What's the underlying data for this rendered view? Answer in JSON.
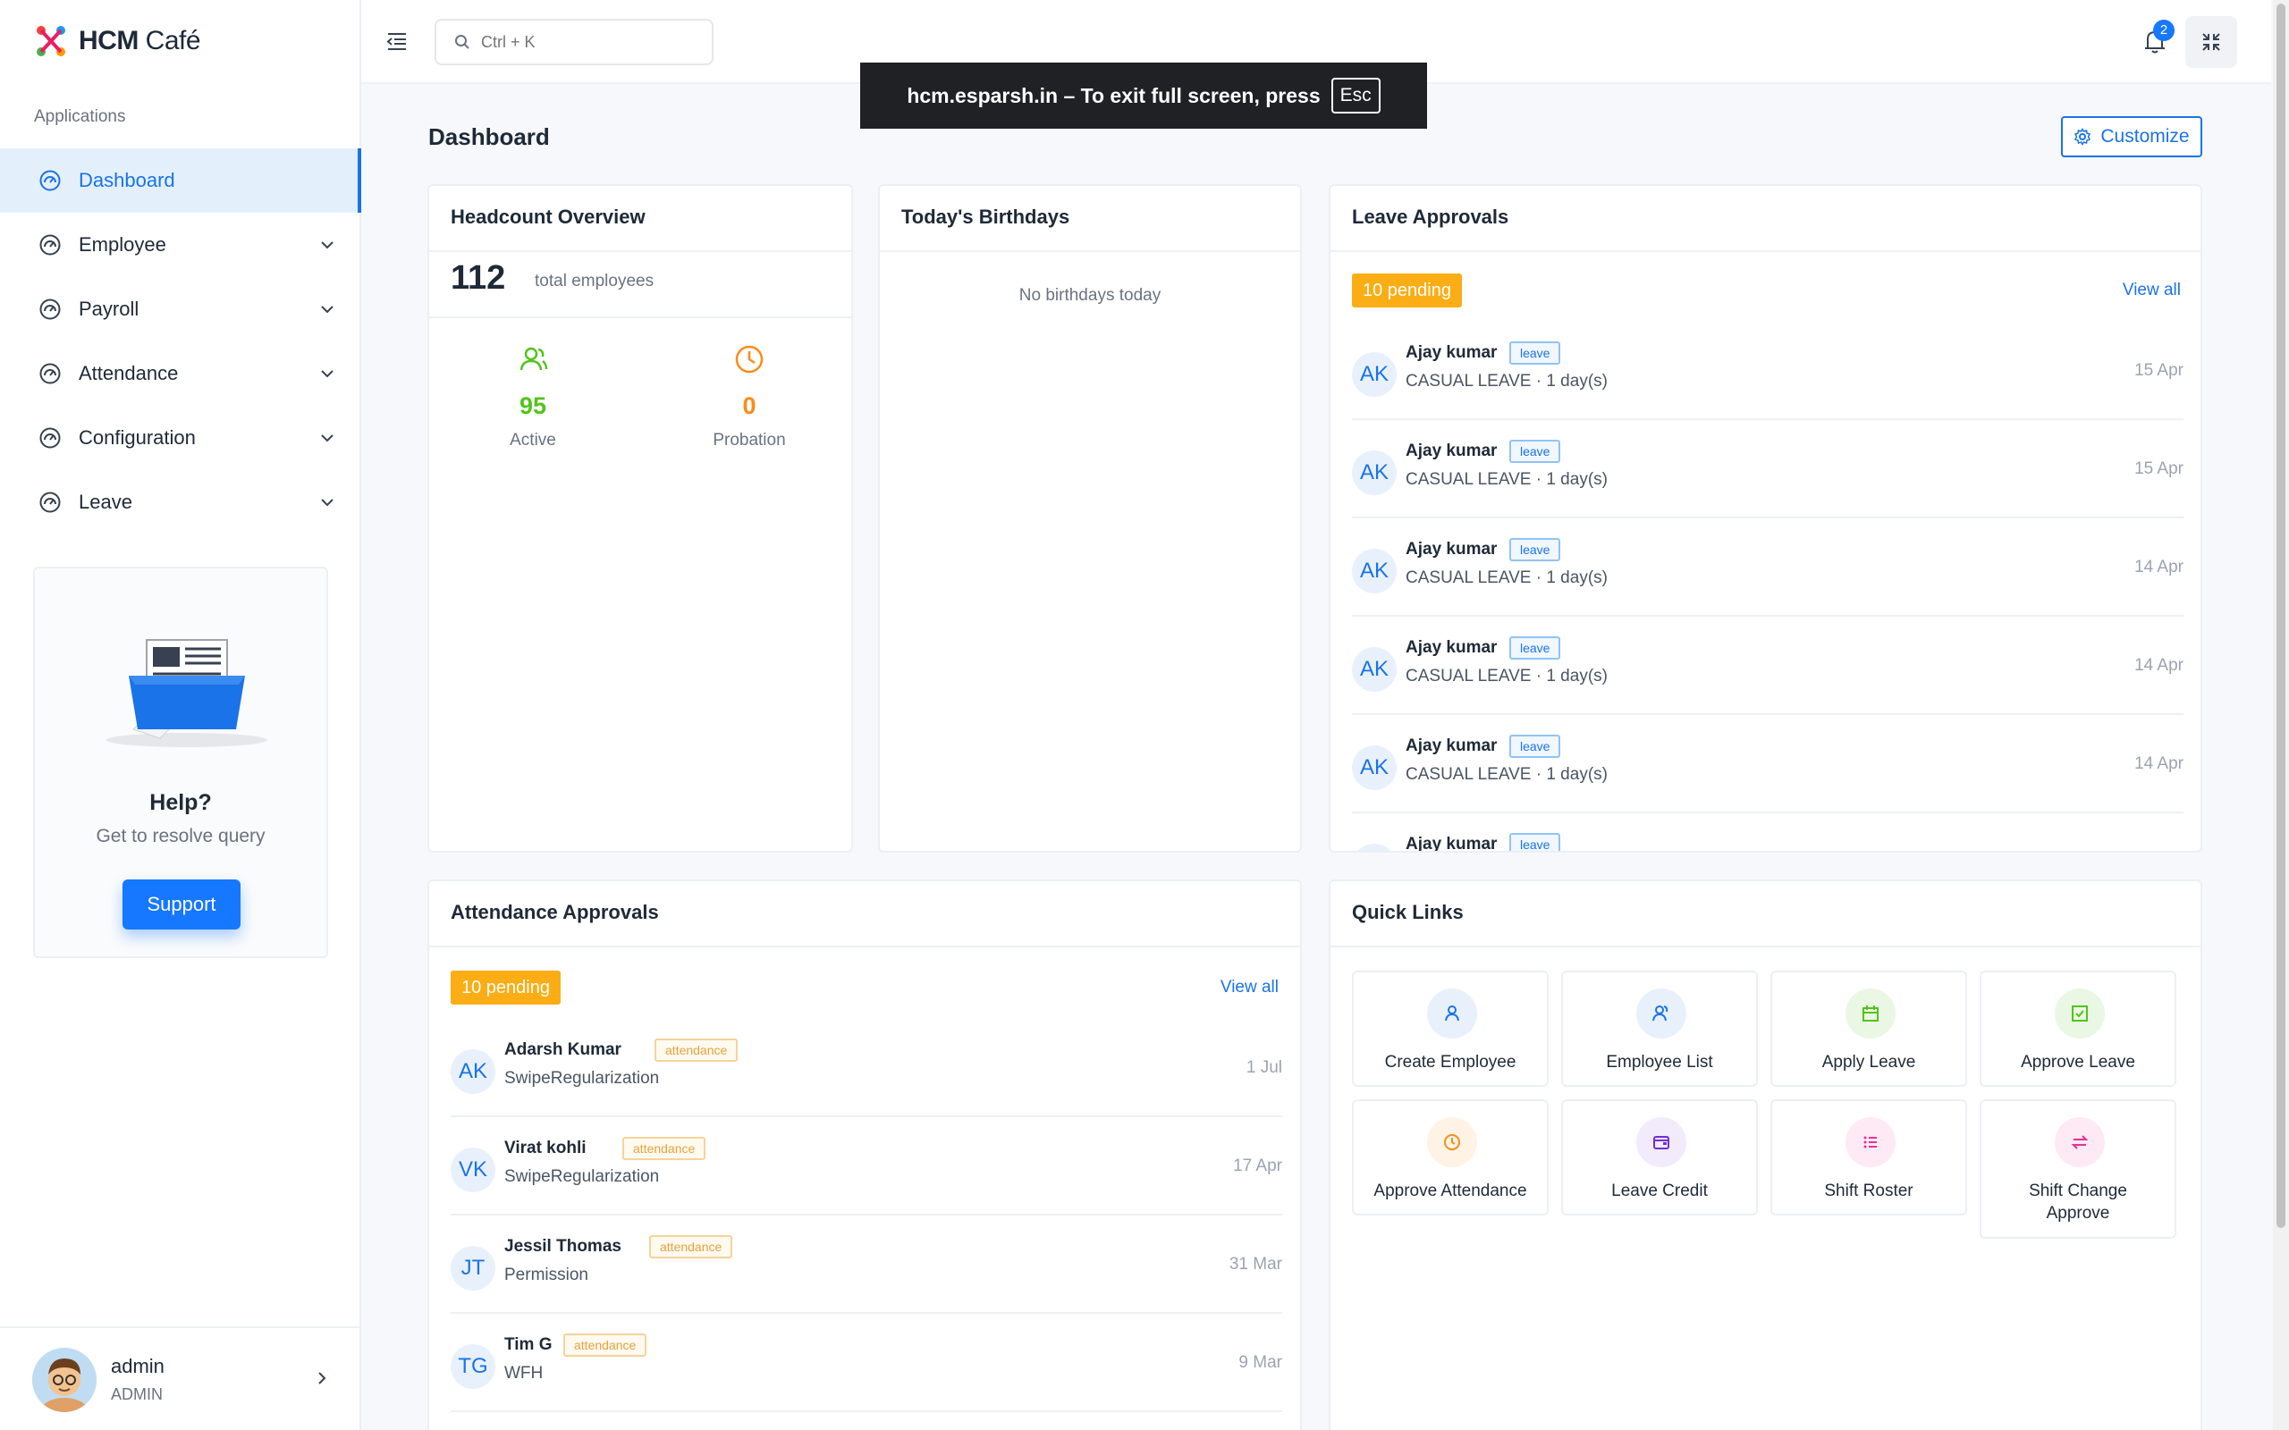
{
  "app": {
    "name_bold": "HCM",
    "name_rest": "Café"
  },
  "sidebar": {
    "section_label": "Applications",
    "items": [
      {
        "label": "Dashboard",
        "icon": "dashboard-icon",
        "active": true
      },
      {
        "label": "Employee",
        "icon": "dashboard-icon"
      },
      {
        "label": "Payroll",
        "icon": "dashboard-icon"
      },
      {
        "label": "Attendance",
        "icon": "dashboard-icon"
      },
      {
        "label": "Configuration",
        "icon": "dashboard-icon"
      },
      {
        "label": "Leave",
        "icon": "dashboard-icon"
      }
    ],
    "help": {
      "title": "Help?",
      "subtitle": "Get to resolve query",
      "button": "Support"
    },
    "user": {
      "name": "admin",
      "role": "ADMIN"
    }
  },
  "topbar": {
    "search_placeholder": "Ctrl + K",
    "notification_count": "2",
    "fullscreen_toast": {
      "text": "hcm.esparsh.in – To exit full screen, press",
      "key": "Esc"
    }
  },
  "page": {
    "title": "Dashboard",
    "customize_label": "Customize"
  },
  "headcount": {
    "title": "Headcount Overview",
    "total": "112",
    "total_label": "total employees",
    "active_value": "95",
    "active_label": "Active",
    "probation_value": "0",
    "probation_label": "Probation"
  },
  "birthdays": {
    "title": "Today's Birthdays",
    "empty": "No birthdays today"
  },
  "leave_approvals": {
    "title": "Leave Approvals",
    "pending": "10 pending",
    "view_all": "View all",
    "rows": [
      {
        "initials": "AK",
        "name": "Ajay kumar",
        "tag": "leave",
        "detail": "CASUAL LEAVE · 1 day(s)",
        "date": "15 Apr"
      },
      {
        "initials": "AK",
        "name": "Ajay kumar",
        "tag": "leave",
        "detail": "CASUAL LEAVE · 1 day(s)",
        "date": "15 Apr"
      },
      {
        "initials": "AK",
        "name": "Ajay kumar",
        "tag": "leave",
        "detail": "CASUAL LEAVE · 1 day(s)",
        "date": "14 Apr"
      },
      {
        "initials": "AK",
        "name": "Ajay kumar",
        "tag": "leave",
        "detail": "CASUAL LEAVE · 1 day(s)",
        "date": "14 Apr"
      },
      {
        "initials": "AK",
        "name": "Ajay kumar",
        "tag": "leave",
        "detail": "CASUAL LEAVE · 1 day(s)",
        "date": "14 Apr"
      },
      {
        "initials": "AK",
        "name": "Ajay kumar",
        "tag": "leave",
        "detail": "",
        "date": ""
      }
    ]
  },
  "attendance_approvals": {
    "title": "Attendance Approvals",
    "pending": "10 pending",
    "view_all": "View all",
    "rows": [
      {
        "initials": "AK",
        "name": "Adarsh Kumar",
        "tag": "attendance",
        "detail": "SwipeRegularization",
        "date": "1 Jul"
      },
      {
        "initials": "VK",
        "name": "Virat kohli",
        "tag": "attendance",
        "detail": "SwipeRegularization",
        "date": "17 Apr"
      },
      {
        "initials": "JT",
        "name": "Jessil Thomas",
        "tag": "attendance",
        "detail": "Permission",
        "date": "31 Mar"
      },
      {
        "initials": "TG",
        "name": "Tim G",
        "tag": "attendance",
        "detail": "WFH",
        "date": "9 Mar"
      }
    ]
  },
  "quick_links": {
    "title": "Quick Links",
    "items": [
      {
        "label": "Create Employee",
        "icon": "user-add-icon",
        "color": "#1a73e8",
        "bg": "#e8f1fb"
      },
      {
        "label": "Employee List",
        "icon": "users-icon",
        "color": "#1a73e8",
        "bg": "#e8f1fb"
      },
      {
        "label": "Apply Leave",
        "icon": "calendar-icon",
        "color": "#52c41a",
        "bg": "#eaf7e4"
      },
      {
        "label": "Approve Leave",
        "icon": "check-square-icon",
        "color": "#52c41a",
        "bg": "#eaf7e4"
      },
      {
        "label": "Approve Attendance",
        "icon": "clock-icon",
        "color": "#fa8c16",
        "bg": "#fff3e6"
      },
      {
        "label": "Leave Credit",
        "icon": "wallet-icon",
        "color": "#722ed1",
        "bg": "#f2ebfb"
      },
      {
        "label": "Shift Roster",
        "icon": "list-icon",
        "color": "#eb2f96",
        "bg": "#fdeaf4"
      },
      {
        "label": "Shift Change Approve",
        "icon": "swap-icon",
        "color": "#eb2f96",
        "bg": "#fdeaf4"
      }
    ]
  },
  "colors": {
    "primary": "#1a73e8",
    "pending": "#faad14",
    "active_green": "#52c41a",
    "probation_orange": "#fa8c16"
  }
}
